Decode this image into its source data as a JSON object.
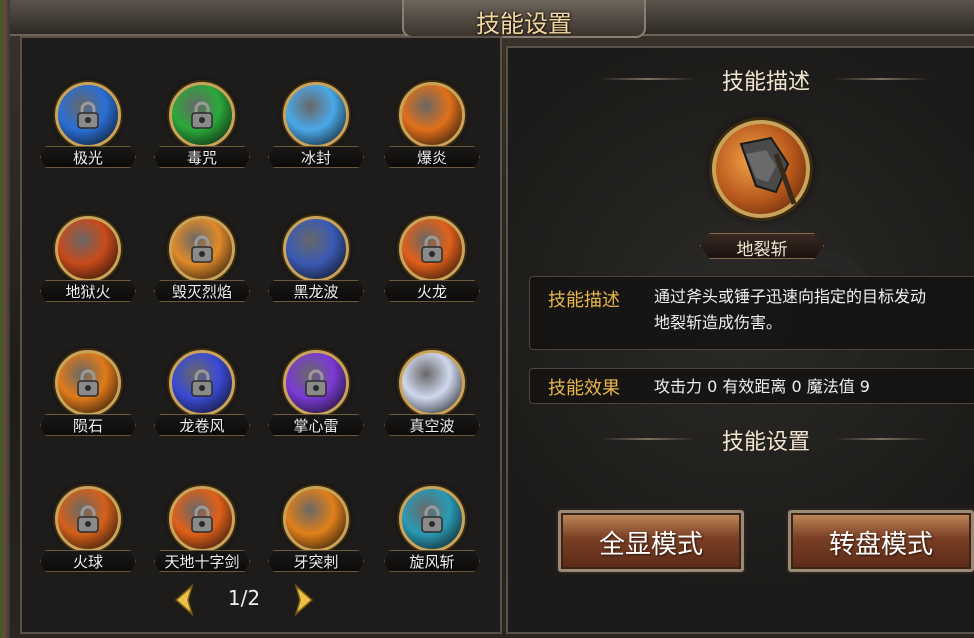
{
  "window": {
    "title": "技能设置"
  },
  "skills": [
    {
      "name": "极光",
      "locked": true,
      "color": "#2a6fd4"
    },
    {
      "name": "毒咒",
      "locked": true,
      "color": "#2aa83a"
    },
    {
      "name": "冰封",
      "locked": false,
      "color": "#4aa8e8"
    },
    {
      "name": "爆炎",
      "locked": false,
      "color": "#e0701a"
    },
    {
      "name": "地狱火",
      "locked": false,
      "color": "#c84a1a"
    },
    {
      "name": "毁灭烈焰",
      "locked": true,
      "color": "#e08a2a"
    },
    {
      "name": "黑龙波",
      "locked": false,
      "color": "#3a5ab4"
    },
    {
      "name": "火龙",
      "locked": true,
      "color": "#e0601a"
    },
    {
      "name": "陨石",
      "locked": true,
      "color": "#e07a1a"
    },
    {
      "name": "龙卷风",
      "locked": true,
      "color": "#3a4ad4"
    },
    {
      "name": "掌心雷",
      "locked": true,
      "color": "#7a3ad4"
    },
    {
      "name": "真空波",
      "locked": false,
      "color": "#cfd8ee"
    },
    {
      "name": "火球",
      "locked": true,
      "color": "#d4601a"
    },
    {
      "name": "天地十字剑",
      "locked": true,
      "color": "#e0601a"
    },
    {
      "name": "牙突刺",
      "locked": false,
      "color": "#e0801a"
    },
    {
      "name": "旋风斩",
      "locked": true,
      "color": "#2a9ab4"
    }
  ],
  "pager": {
    "page": "1/2"
  },
  "detail": {
    "header": "技能描述",
    "selected_skill": "地裂斩",
    "desc_key": "技能描述",
    "desc_line1": "通过斧头或锤子迅速向指定的目标发动",
    "desc_line2": "地裂斩造成伤害。",
    "effect_key": "技能效果",
    "effect_val": "攻击力 0  有效距离 0  魔法值 9",
    "settings_header": "技能设置",
    "mode_full": "全显模式",
    "mode_wheel": "转盘模式"
  }
}
